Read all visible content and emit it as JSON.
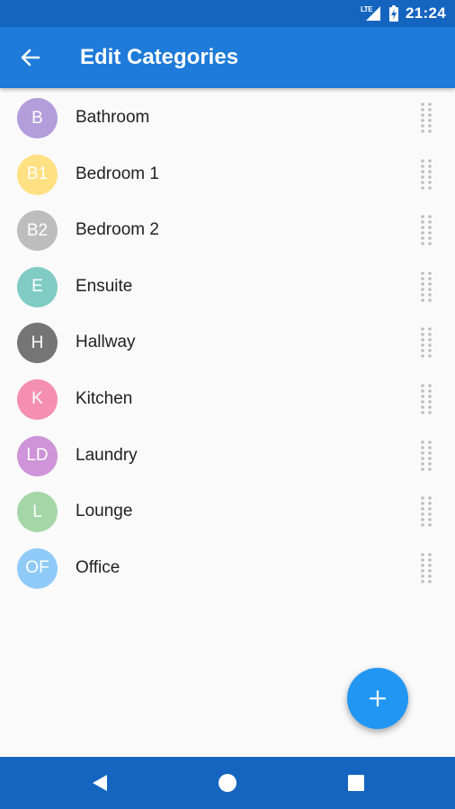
{
  "status_bar": {
    "network": "LTE",
    "time": "21:24"
  },
  "app_bar": {
    "title": "Edit Categories",
    "back_icon": "arrow-back-icon"
  },
  "categories": [
    {
      "initials": "B",
      "label": "Bathroom",
      "color": "#b39ddb"
    },
    {
      "initials": "B1",
      "label": "Bedroom 1",
      "color": "#ffe082"
    },
    {
      "initials": "B2",
      "label": "Bedroom 2",
      "color": "#bdbdbd"
    },
    {
      "initials": "E",
      "label": "Ensuite",
      "color": "#80cbc4"
    },
    {
      "initials": "H",
      "label": "Hallway",
      "color": "#757575"
    },
    {
      "initials": "K",
      "label": "Kitchen",
      "color": "#f48fb1"
    },
    {
      "initials": "LD",
      "label": "Laundry",
      "color": "#ce93d8"
    },
    {
      "initials": "L",
      "label": "Lounge",
      "color": "#a5d6a7"
    },
    {
      "initials": "OF",
      "label": "Office",
      "color": "#90caf9"
    }
  ],
  "fab": {
    "icon": "add-icon"
  },
  "nav_bar": {
    "icons": [
      "back-triangle-icon",
      "home-circle-icon",
      "recents-square-icon"
    ]
  },
  "colors": {
    "status_bar": "#1565c0",
    "app_bar": "#1e7bd9",
    "fab": "#2196f3",
    "background": "#fafafa",
    "drag_handle": "#bdbdbd"
  }
}
